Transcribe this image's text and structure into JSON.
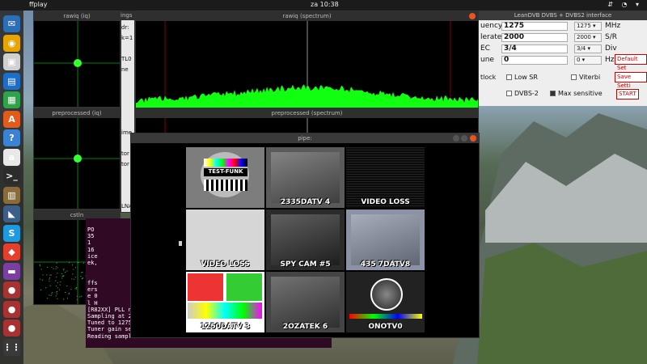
{
  "topbar": {
    "activities": "ffplay",
    "clock": "za 10:38",
    "tray": "⇵ ◔ ▾"
  },
  "dock": [
    {
      "name": "mail",
      "color": "#2d6fb7",
      "glyph": "✉"
    },
    {
      "name": "browser",
      "color": "#e8a400",
      "glyph": "◉"
    },
    {
      "name": "files",
      "color": "#d0d0d0",
      "glyph": "▣"
    },
    {
      "name": "writer",
      "color": "#1c6fc9",
      "glyph": "▤"
    },
    {
      "name": "calc",
      "color": "#2fa34a",
      "glyph": "▦"
    },
    {
      "name": "store",
      "color": "#e35b1b",
      "glyph": "A"
    },
    {
      "name": "help",
      "color": "#3a82d6",
      "glyph": "?"
    },
    {
      "name": "amazon",
      "color": "#e8e8e8",
      "glyph": "a"
    },
    {
      "name": "terminal",
      "color": "#2c2c2c",
      "glyph": ">_"
    },
    {
      "name": "archive",
      "color": "#8a6b3a",
      "glyph": "▥"
    },
    {
      "name": "sdr",
      "color": "#3c5f8a",
      "glyph": "◣"
    },
    {
      "name": "skype",
      "color": "#1e9be0",
      "glyph": "S"
    },
    {
      "name": "anydesk",
      "color": "#e53e2c",
      "glyph": "◆"
    },
    {
      "name": "screen",
      "color": "#7b3fa3",
      "glyph": "▬"
    },
    {
      "name": "record1",
      "color": "#a83232",
      "glyph": "●"
    },
    {
      "name": "record2",
      "color": "#a83232",
      "glyph": "●"
    },
    {
      "name": "record3",
      "color": "#a83232",
      "glyph": "●"
    },
    {
      "name": "apps",
      "color": "#3a3a3a",
      "glyph": "⋮⋮"
    }
  ],
  "windows": {
    "rawiq": "rawiq (iq)",
    "preproc_iq": "preprocessed (iq)",
    "cstln": "cstln",
    "rawiq_spec": "rawiq (spectrum)",
    "preproc_spec": "preprocessed (spectrum)",
    "pipe": "pipe:",
    "settings_frag": "ings"
  },
  "settings_frag_lines": [
    "dr:",
    "k=1",
    "",
    "TL0",
    "ne",
    "",
    "",
    "",
    "",
    "",
    "ime",
    "",
    "tor",
    "tor",
    "",
    "",
    "",
    "LNA"
  ],
  "leandvb": {
    "title": "LeanDVB DVBS + DVBS2 interface",
    "rows": [
      {
        "label": "uency",
        "value": "1275",
        "select": "1275",
        "unit": "MHz"
      },
      {
        "label": "lerate",
        "value": "2000",
        "select": "2000",
        "unit": "S/R"
      },
      {
        "label": "EC",
        "value": "3/4",
        "select": "3/4",
        "unit": "Div"
      },
      {
        "label": "une",
        "value": "0",
        "select": "0",
        "unit": "Hz"
      }
    ],
    "checks": [
      {
        "label": "Low SR",
        "checked": false
      },
      {
        "label": "Viterbi",
        "checked": false
      },
      {
        "label": "DVBS-2",
        "checked": false
      },
      {
        "label": "Max sensitive",
        "checked": true
      }
    ],
    "frag_lock": "tlock",
    "buttons": {
      "default": "Default Set",
      "save": "Save Setti",
      "start": "START"
    }
  },
  "terminal_lines": [
    "ffs",
    "ers",
    "e 0",
    "l H",
    "[R82XX] PLL no",
    "Sampling at 24",
    "Tuned to 12750",
    "Tuner gain set",
    "Reading sample"
  ],
  "terminal_left": [
    "PO",
    "35",
    "1",
    "16",
    "ice",
    "ek,"
  ],
  "tiles": [
    {
      "caption": "",
      "bg": "#7d7d7d",
      "kind": "testcard",
      "label": "TEST-FUNK"
    },
    {
      "caption": "2335DATV 4",
      "bg": "#5a5a5a",
      "kind": "lab"
    },
    {
      "caption": "VIDEO LOSS",
      "bg": "#000000",
      "kind": "noise"
    },
    {
      "caption": "VIDEO LOSS",
      "bg": "#d6d6d6",
      "kind": "plain"
    },
    {
      "caption": "SPY CAM #5",
      "bg": "#2b2b2b",
      "kind": "lab"
    },
    {
      "caption": "435 7DATV8",
      "bg": "#8b92a5",
      "kind": "lab"
    },
    {
      "caption": "1250DATV 3",
      "bg": "#ffffff",
      "kind": "spectrum"
    },
    {
      "caption": "2OZATEK 6",
      "bg": "#444444",
      "kind": "lab"
    },
    {
      "caption": "ONOTV0",
      "bg": "#222222",
      "kind": "testcard2"
    }
  ],
  "video_loss_top": "VIDEO LOSS"
}
